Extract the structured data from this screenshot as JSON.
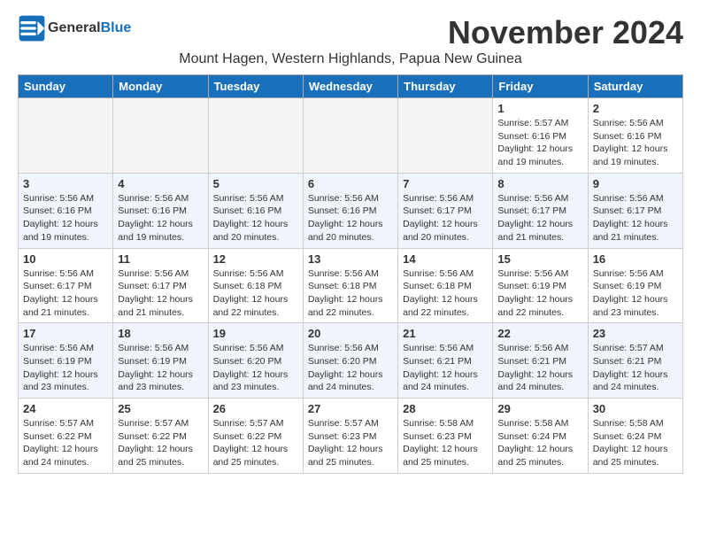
{
  "logo": {
    "line1": "General",
    "line2": "Blue"
  },
  "title": "November 2024",
  "subtitle": "Mount Hagen, Western Highlands, Papua New Guinea",
  "days_of_week": [
    "Sunday",
    "Monday",
    "Tuesday",
    "Wednesday",
    "Thursday",
    "Friday",
    "Saturday"
  ],
  "weeks": [
    [
      {
        "day": "",
        "info": ""
      },
      {
        "day": "",
        "info": ""
      },
      {
        "day": "",
        "info": ""
      },
      {
        "day": "",
        "info": ""
      },
      {
        "day": "",
        "info": ""
      },
      {
        "day": "1",
        "info": "Sunrise: 5:57 AM\nSunset: 6:16 PM\nDaylight: 12 hours and 19 minutes."
      },
      {
        "day": "2",
        "info": "Sunrise: 5:56 AM\nSunset: 6:16 PM\nDaylight: 12 hours and 19 minutes."
      }
    ],
    [
      {
        "day": "3",
        "info": "Sunrise: 5:56 AM\nSunset: 6:16 PM\nDaylight: 12 hours and 19 minutes."
      },
      {
        "day": "4",
        "info": "Sunrise: 5:56 AM\nSunset: 6:16 PM\nDaylight: 12 hours and 19 minutes."
      },
      {
        "day": "5",
        "info": "Sunrise: 5:56 AM\nSunset: 6:16 PM\nDaylight: 12 hours and 20 minutes."
      },
      {
        "day": "6",
        "info": "Sunrise: 5:56 AM\nSunset: 6:16 PM\nDaylight: 12 hours and 20 minutes."
      },
      {
        "day": "7",
        "info": "Sunrise: 5:56 AM\nSunset: 6:17 PM\nDaylight: 12 hours and 20 minutes."
      },
      {
        "day": "8",
        "info": "Sunrise: 5:56 AM\nSunset: 6:17 PM\nDaylight: 12 hours and 21 minutes."
      },
      {
        "day": "9",
        "info": "Sunrise: 5:56 AM\nSunset: 6:17 PM\nDaylight: 12 hours and 21 minutes."
      }
    ],
    [
      {
        "day": "10",
        "info": "Sunrise: 5:56 AM\nSunset: 6:17 PM\nDaylight: 12 hours and 21 minutes."
      },
      {
        "day": "11",
        "info": "Sunrise: 5:56 AM\nSunset: 6:17 PM\nDaylight: 12 hours and 21 minutes."
      },
      {
        "day": "12",
        "info": "Sunrise: 5:56 AM\nSunset: 6:18 PM\nDaylight: 12 hours and 22 minutes."
      },
      {
        "day": "13",
        "info": "Sunrise: 5:56 AM\nSunset: 6:18 PM\nDaylight: 12 hours and 22 minutes."
      },
      {
        "day": "14",
        "info": "Sunrise: 5:56 AM\nSunset: 6:18 PM\nDaylight: 12 hours and 22 minutes."
      },
      {
        "day": "15",
        "info": "Sunrise: 5:56 AM\nSunset: 6:19 PM\nDaylight: 12 hours and 22 minutes."
      },
      {
        "day": "16",
        "info": "Sunrise: 5:56 AM\nSunset: 6:19 PM\nDaylight: 12 hours and 23 minutes."
      }
    ],
    [
      {
        "day": "17",
        "info": "Sunrise: 5:56 AM\nSunset: 6:19 PM\nDaylight: 12 hours and 23 minutes."
      },
      {
        "day": "18",
        "info": "Sunrise: 5:56 AM\nSunset: 6:19 PM\nDaylight: 12 hours and 23 minutes."
      },
      {
        "day": "19",
        "info": "Sunrise: 5:56 AM\nSunset: 6:20 PM\nDaylight: 12 hours and 23 minutes."
      },
      {
        "day": "20",
        "info": "Sunrise: 5:56 AM\nSunset: 6:20 PM\nDaylight: 12 hours and 24 minutes."
      },
      {
        "day": "21",
        "info": "Sunrise: 5:56 AM\nSunset: 6:21 PM\nDaylight: 12 hours and 24 minutes."
      },
      {
        "day": "22",
        "info": "Sunrise: 5:56 AM\nSunset: 6:21 PM\nDaylight: 12 hours and 24 minutes."
      },
      {
        "day": "23",
        "info": "Sunrise: 5:57 AM\nSunset: 6:21 PM\nDaylight: 12 hours and 24 minutes."
      }
    ],
    [
      {
        "day": "24",
        "info": "Sunrise: 5:57 AM\nSunset: 6:22 PM\nDaylight: 12 hours and 24 minutes."
      },
      {
        "day": "25",
        "info": "Sunrise: 5:57 AM\nSunset: 6:22 PM\nDaylight: 12 hours and 25 minutes."
      },
      {
        "day": "26",
        "info": "Sunrise: 5:57 AM\nSunset: 6:22 PM\nDaylight: 12 hours and 25 minutes."
      },
      {
        "day": "27",
        "info": "Sunrise: 5:57 AM\nSunset: 6:23 PM\nDaylight: 12 hours and 25 minutes."
      },
      {
        "day": "28",
        "info": "Sunrise: 5:58 AM\nSunset: 6:23 PM\nDaylight: 12 hours and 25 minutes."
      },
      {
        "day": "29",
        "info": "Sunrise: 5:58 AM\nSunset: 6:24 PM\nDaylight: 12 hours and 25 minutes."
      },
      {
        "day": "30",
        "info": "Sunrise: 5:58 AM\nSunset: 6:24 PM\nDaylight: 12 hours and 25 minutes."
      }
    ]
  ]
}
